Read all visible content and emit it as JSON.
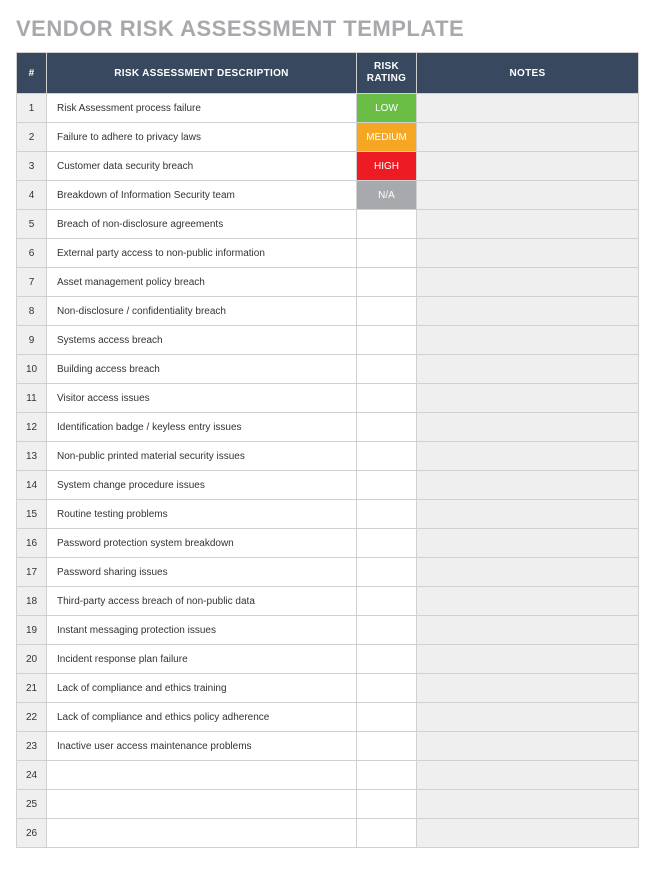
{
  "title": "VENDOR RISK ASSESSMENT TEMPLATE",
  "columns": {
    "num": "#",
    "desc": "RISK ASSESSMENT DESCRIPTION",
    "rating": "RISK RATING",
    "notes": "NOTES"
  },
  "rating_colors": {
    "LOW": "rating-low",
    "MEDIUM": "rating-medium",
    "HIGH": "rating-high",
    "N/A": "rating-na"
  },
  "rows": [
    {
      "num": "1",
      "desc": "Risk Assessment process failure",
      "rating": "LOW",
      "notes": ""
    },
    {
      "num": "2",
      "desc": "Failure to adhere to privacy laws",
      "rating": "MEDIUM",
      "notes": ""
    },
    {
      "num": "3",
      "desc": "Customer data security breach",
      "rating": "HIGH",
      "notes": ""
    },
    {
      "num": "4",
      "desc": "Breakdown of Information Security team",
      "rating": "N/A",
      "notes": ""
    },
    {
      "num": "5",
      "desc": "Breach of non-disclosure agreements",
      "rating": "",
      "notes": ""
    },
    {
      "num": "6",
      "desc": "External party access to non-public information",
      "rating": "",
      "notes": ""
    },
    {
      "num": "7",
      "desc": "Asset management policy breach",
      "rating": "",
      "notes": ""
    },
    {
      "num": "8",
      "desc": "Non-disclosure / confidentiality breach",
      "rating": "",
      "notes": ""
    },
    {
      "num": "9",
      "desc": "Systems access breach",
      "rating": "",
      "notes": ""
    },
    {
      "num": "10",
      "desc": "Building access breach",
      "rating": "",
      "notes": ""
    },
    {
      "num": "11",
      "desc": "Visitor access issues",
      "rating": "",
      "notes": ""
    },
    {
      "num": "12",
      "desc": "Identification badge / keyless entry issues",
      "rating": "",
      "notes": ""
    },
    {
      "num": "13",
      "desc": "Non-public printed material security issues",
      "rating": "",
      "notes": ""
    },
    {
      "num": "14",
      "desc": "System change procedure issues",
      "rating": "",
      "notes": ""
    },
    {
      "num": "15",
      "desc": "Routine testing problems",
      "rating": "",
      "notes": ""
    },
    {
      "num": "16",
      "desc": "Password protection system breakdown",
      "rating": "",
      "notes": ""
    },
    {
      "num": "17",
      "desc": "Password sharing issues",
      "rating": "",
      "notes": ""
    },
    {
      "num": "18",
      "desc": "Third-party access breach of non-public data",
      "rating": "",
      "notes": ""
    },
    {
      "num": "19",
      "desc": "Instant messaging protection issues",
      "rating": "",
      "notes": ""
    },
    {
      "num": "20",
      "desc": "Incident response plan failure",
      "rating": "",
      "notes": ""
    },
    {
      "num": "21",
      "desc": "Lack of compliance and ethics training",
      "rating": "",
      "notes": ""
    },
    {
      "num": "22",
      "desc": "Lack of compliance and ethics policy adherence",
      "rating": "",
      "notes": ""
    },
    {
      "num": "23",
      "desc": "Inactive user access maintenance problems",
      "rating": "",
      "notes": ""
    },
    {
      "num": "24",
      "desc": "",
      "rating": "",
      "notes": ""
    },
    {
      "num": "25",
      "desc": "",
      "rating": "",
      "notes": ""
    },
    {
      "num": "26",
      "desc": "",
      "rating": "",
      "notes": ""
    }
  ]
}
